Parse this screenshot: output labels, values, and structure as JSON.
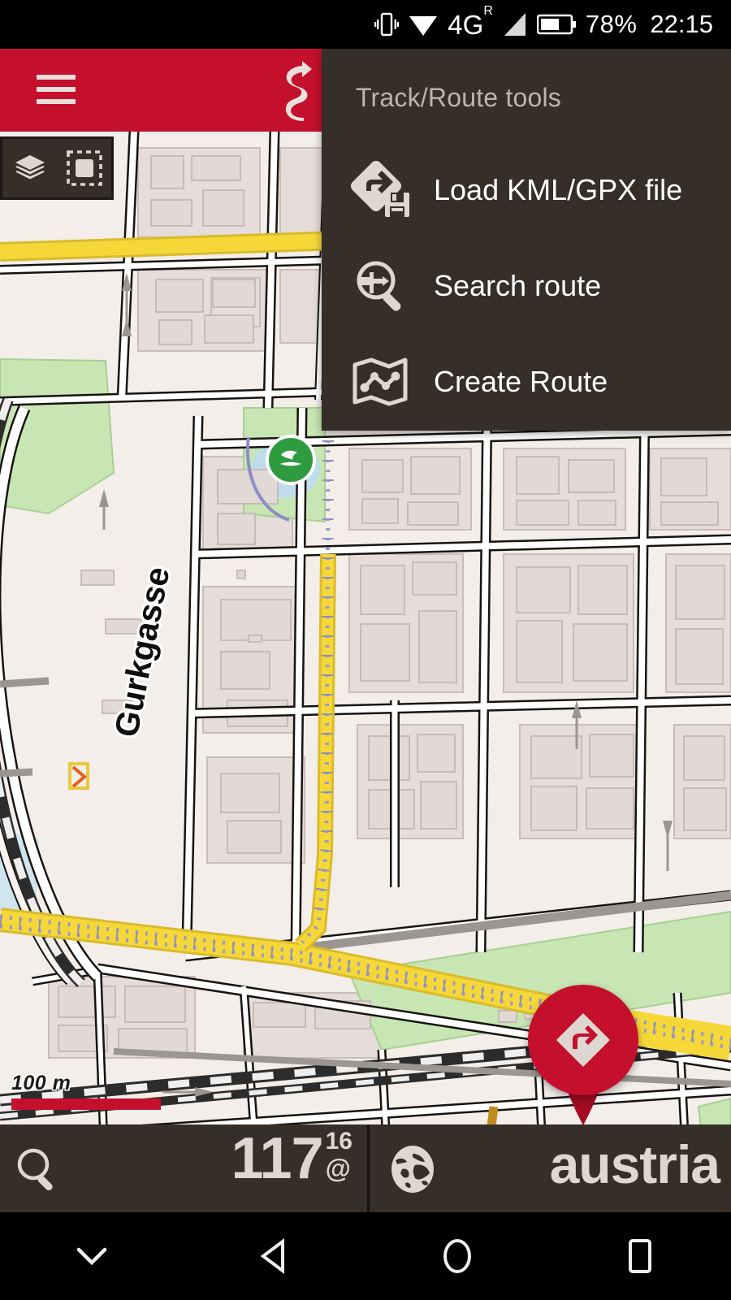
{
  "statusbar": {
    "network_label": "4G",
    "network_sup": "R",
    "battery_percent": "78%",
    "time": "22:15",
    "icons": [
      "vibrate-icon",
      "wifi-icon",
      "signal-bars-icon",
      "battery-icon"
    ]
  },
  "appbar": {
    "menu_icon": "hamburger-menu-icon",
    "route_icon": "winding-route-icon",
    "accent_color": "#c4102c"
  },
  "map_toolbar": {
    "layers_icon": "layers-icon",
    "select_area_icon": "dashed-square-select-icon"
  },
  "map": {
    "street_label": "Gurkgasse",
    "scale_label": "100 m",
    "poi_icon": "park-recreation-icon",
    "marker_icon": "map-pin-icon",
    "fab_icon": "turn-right-navigation-icon",
    "background_color": "#f3eee9",
    "building_color": "#e2d8d5",
    "main_road_color": "#f5d838",
    "park_color": "#c8e6b4",
    "water_color": "#cfe5ef",
    "tram_color": "#9a9ac8"
  },
  "menu": {
    "title": "Track/Route tools",
    "background_color": "#352e29",
    "items": [
      {
        "label": "Load KML/GPX file",
        "icon": "load-file-route-icon"
      },
      {
        "label": "Search route",
        "icon": "search-route-icon"
      },
      {
        "label": "Create Route",
        "icon": "create-route-map-icon"
      }
    ]
  },
  "bottombar": {
    "search_icon": "search-icon",
    "counter_value": "117",
    "counter_superscript": "16",
    "counter_at": "@",
    "globe_icon": "globe-icon",
    "country": "austria",
    "background_color": "#352e29"
  },
  "navbar": {
    "buttons": [
      {
        "icon": "chevron-down-icon"
      },
      {
        "icon": "back-triangle-icon"
      },
      {
        "icon": "home-circle-icon"
      },
      {
        "icon": "recents-square-icon"
      }
    ]
  }
}
